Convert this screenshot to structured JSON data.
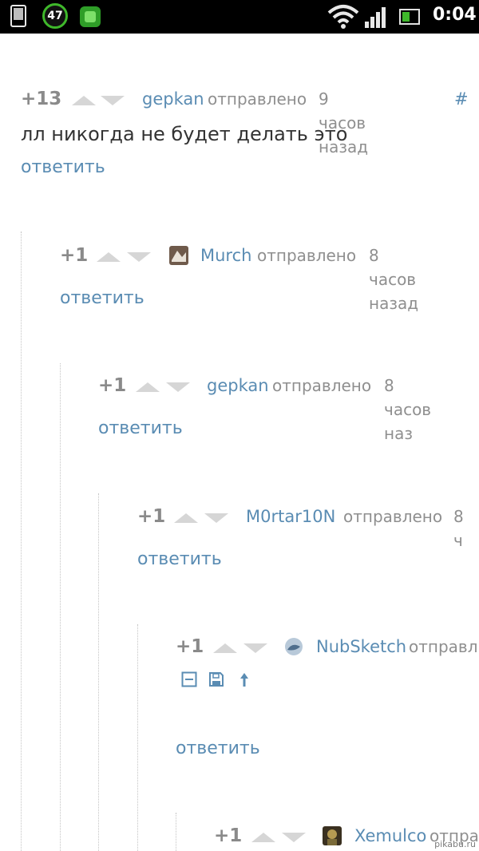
{
  "status_bar": {
    "badge_number": "47",
    "clock": "0:04"
  },
  "comments": [
    {
      "score": "+13",
      "author": "gepkan",
      "sent_label": "отправлено",
      "time": "9 часов назад",
      "hash": "#",
      "text": "лл никогда не будет делать это",
      "reply": "ответить"
    },
    {
      "score": "+1",
      "author": "Murch",
      "sent_label": "отправлено",
      "time": "8 часов назад",
      "reply": "ответить"
    },
    {
      "score": "+1",
      "author": "gepkan",
      "sent_label": "отправлено",
      "time": "8 часов наз",
      "reply": "ответить"
    },
    {
      "score": "+1",
      "author": "M0rtar10N",
      "sent_label": "отправлено",
      "time": "8 ч",
      "reply": "ответить"
    },
    {
      "score": "+1",
      "author": "NubSketch",
      "sent_label": "отправл",
      "reply": "ответить"
    },
    {
      "score": "+1",
      "author": "Xemulco",
      "sent_label": "отпра"
    }
  ],
  "watermark": "pikabu.ru",
  "colors": {
    "link": "#5a8cb3",
    "muted": "#8f8f8f",
    "score": "#8a8a8a",
    "text": "#333333",
    "vote_arrow": "#d6d6d6",
    "status_bar": "#000000",
    "battery": "#3fb82b"
  }
}
